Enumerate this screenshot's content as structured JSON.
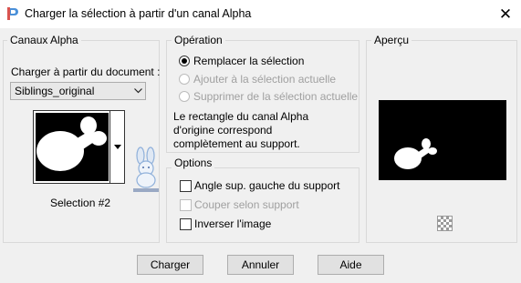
{
  "window": {
    "title": "Charger la sélection à partir d'un canal Alpha",
    "close_symbol": "✕"
  },
  "left_panel": {
    "group_label": "Canaux Alpha",
    "source_label": "Charger à partir du document :",
    "document_value": "Siblings_original",
    "channel_name": "Selection #2"
  },
  "operation": {
    "group_label": "Opération",
    "options": [
      {
        "label": "Remplacer la sélection",
        "selected": true,
        "enabled": true
      },
      {
        "label": "Ajouter à la sélection actuelle",
        "selected": false,
        "enabled": false
      },
      {
        "label": "Supprimer de la sélection actuelle",
        "selected": false,
        "enabled": false
      }
    ],
    "description": "Le rectangle du canal Alpha d'origine correspond complètement au support."
  },
  "options": {
    "group_label": "Options",
    "checkboxes": [
      {
        "label": "Angle sup. gauche du support",
        "checked": false,
        "enabled": true
      },
      {
        "label": "Couper selon support",
        "checked": false,
        "enabled": false
      },
      {
        "label": "Inverser l'image",
        "checked": false,
        "enabled": true
      }
    ]
  },
  "preview": {
    "group_label": "Aperçu"
  },
  "buttons": {
    "load": "Charger",
    "cancel": "Annuler",
    "help": "Aide"
  },
  "colors": {
    "window_bg": "#f0f0f0",
    "preview_bg": "#000000",
    "shape": "#ffffff"
  }
}
